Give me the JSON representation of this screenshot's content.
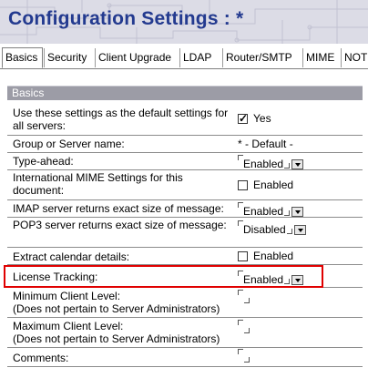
{
  "window": {
    "title": "Configuration Settings : *"
  },
  "tabs": [
    {
      "label": "Basics",
      "active": true
    },
    {
      "label": "Security"
    },
    {
      "label": "Client Upgrade"
    },
    {
      "label": "LDAP"
    },
    {
      "label": "Router/SMTP"
    },
    {
      "label": "MIME"
    },
    {
      "label": "NOT"
    }
  ],
  "section": {
    "title": "Basics"
  },
  "rows": [
    {
      "label": "Use these settings as the default settings for all servers:",
      "value": "Yes",
      "control": "checkbox",
      "checked": true
    },
    {
      "label": "Group or Server name:",
      "value": "* - Default -",
      "control": "text"
    },
    {
      "label": "Type-ahead:",
      "value": "Enabled",
      "control": "dropdown"
    },
    {
      "label": "International MIME Settings for this document:",
      "value": "Enabled",
      "control": "checkbox",
      "checked": false
    },
    {
      "label": "IMAP server returns exact size of message:",
      "value": "Enabled",
      "control": "dropdown"
    },
    {
      "label": "POP3 server returns exact size of message:",
      "value": "Disabled",
      "control": "dropdown"
    },
    {
      "label": "Extract calendar details:",
      "value": "Enabled",
      "control": "checkbox",
      "checked": false
    },
    {
      "label": "License Tracking:",
      "value": "Enabled",
      "control": "dropdown",
      "highlighted": true
    },
    {
      "label": "Minimum Client Level:\n(Does not pertain to Server Administrators)",
      "value": "",
      "control": "field"
    },
    {
      "label": "Maximum Client Level:\n(Does not pertain to Server Administrators)",
      "value": "",
      "control": "field"
    },
    {
      "label": "Comments:",
      "value": "",
      "control": "field"
    }
  ],
  "colors": {
    "title": "#233a8f",
    "section_bg": "#9c9ca6",
    "highlight": "#e00000"
  }
}
